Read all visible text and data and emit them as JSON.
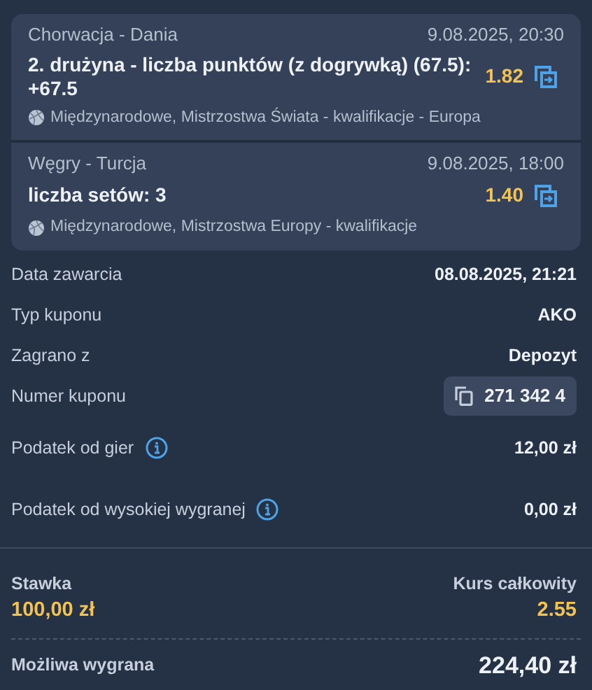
{
  "bets": [
    {
      "match": "Chorwacja - Dania",
      "datetime": "9.08.2025, 20:30",
      "selection": "2. drużyna - liczba punktów (z dogrywką) (67.5): +67.5",
      "odds": "1.82",
      "competition": "Międzynarodowe, Mistrzostwa Świata - kwalifikacje - Europa"
    },
    {
      "match": "Węgry - Turcja",
      "datetime": "9.08.2025, 18:00",
      "selection": "liczba setów: 3",
      "odds": "1.40",
      "competition": "Międzynarodowe, Mistrzostwa Europy - kwalifikacje"
    }
  ],
  "details": [
    {
      "kind": "plain",
      "label": "Data zawarcia",
      "value": "08.08.2025, 21:21"
    },
    {
      "kind": "plain",
      "label": "Typ kuponu",
      "value": "AKO"
    },
    {
      "kind": "plain",
      "label": "Zagrano z",
      "value": "Depozyt"
    },
    {
      "kind": "copy",
      "label": "Numer kuponu",
      "value": "271 342 4"
    },
    {
      "kind": "info",
      "label": "Podatek od gier",
      "value": "12,00 zł"
    },
    {
      "kind": "info",
      "label": "Podatek od wysokiej wygranej",
      "value": "0,00 zł"
    }
  ],
  "summary": {
    "stake_label": "Stawka",
    "stake": "100,00 zł",
    "total_odds_label": "Kurs całkowity",
    "total_odds": "2.55",
    "win_label": "Możliwa wygrana",
    "win": "224,40 zł"
  }
}
